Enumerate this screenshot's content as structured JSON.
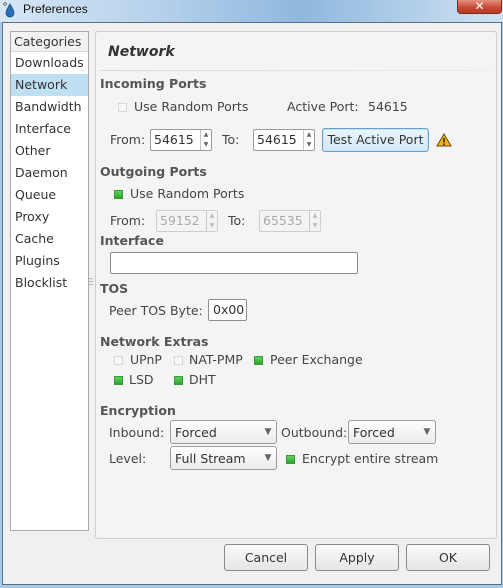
{
  "window": {
    "title": "Preferences",
    "close_label": "✕"
  },
  "sidebar": {
    "header": "Categories",
    "items": [
      {
        "label": "Downloads",
        "selected": false
      },
      {
        "label": "Network",
        "selected": true
      },
      {
        "label": "Bandwidth",
        "selected": false
      },
      {
        "label": "Interface",
        "selected": false
      },
      {
        "label": "Other",
        "selected": false
      },
      {
        "label": "Daemon",
        "selected": false
      },
      {
        "label": "Queue",
        "selected": false
      },
      {
        "label": "Proxy",
        "selected": false
      },
      {
        "label": "Cache",
        "selected": false
      },
      {
        "label": "Plugins",
        "selected": false
      },
      {
        "label": "Blocklist",
        "selected": false
      }
    ]
  },
  "page": {
    "title": "Network",
    "incoming": {
      "heading": "Incoming Ports",
      "random_label": "Use Random Ports",
      "random_checked": false,
      "active_port_label": "Active Port:",
      "active_port_value": "54615",
      "from_label": "From:",
      "from_value": "54615",
      "to_label": "To:",
      "to_value": "54615",
      "test_button": "Test Active Port",
      "status_icon": "warning-icon"
    },
    "outgoing": {
      "heading": "Outgoing Ports",
      "random_label": "Use Random Ports",
      "random_checked": true,
      "from_label": "From:",
      "from_value": "59152",
      "to_label": "To:",
      "to_value": "65535"
    },
    "interface": {
      "heading": "Interface",
      "value": ""
    },
    "tos": {
      "heading": "TOS",
      "label": "Peer TOS Byte:",
      "value": "0x00"
    },
    "extras": {
      "heading": "Network Extras",
      "upnp": {
        "label": "UPnP",
        "checked": false
      },
      "natpmp": {
        "label": "NAT-PMP",
        "checked": false
      },
      "pex": {
        "label": "Peer Exchange",
        "checked": true
      },
      "lsd": {
        "label": "LSD",
        "checked": true
      },
      "dht": {
        "label": "DHT",
        "checked": true
      }
    },
    "encryption": {
      "heading": "Encryption",
      "inbound_label": "Inbound:",
      "inbound_value": "Forced",
      "outbound_label": "Outbound:",
      "outbound_value": "Forced",
      "level_label": "Level:",
      "level_value": "Full Stream",
      "encrypt_stream_label": "Encrypt entire stream",
      "encrypt_stream_checked": true
    }
  },
  "buttons": {
    "cancel": "Cancel",
    "apply": "Apply",
    "ok": "OK"
  },
  "colors": {
    "selection": "#bfdff3",
    "checkbox_checked": "#3fb83f",
    "warning": "#e8a21a"
  }
}
